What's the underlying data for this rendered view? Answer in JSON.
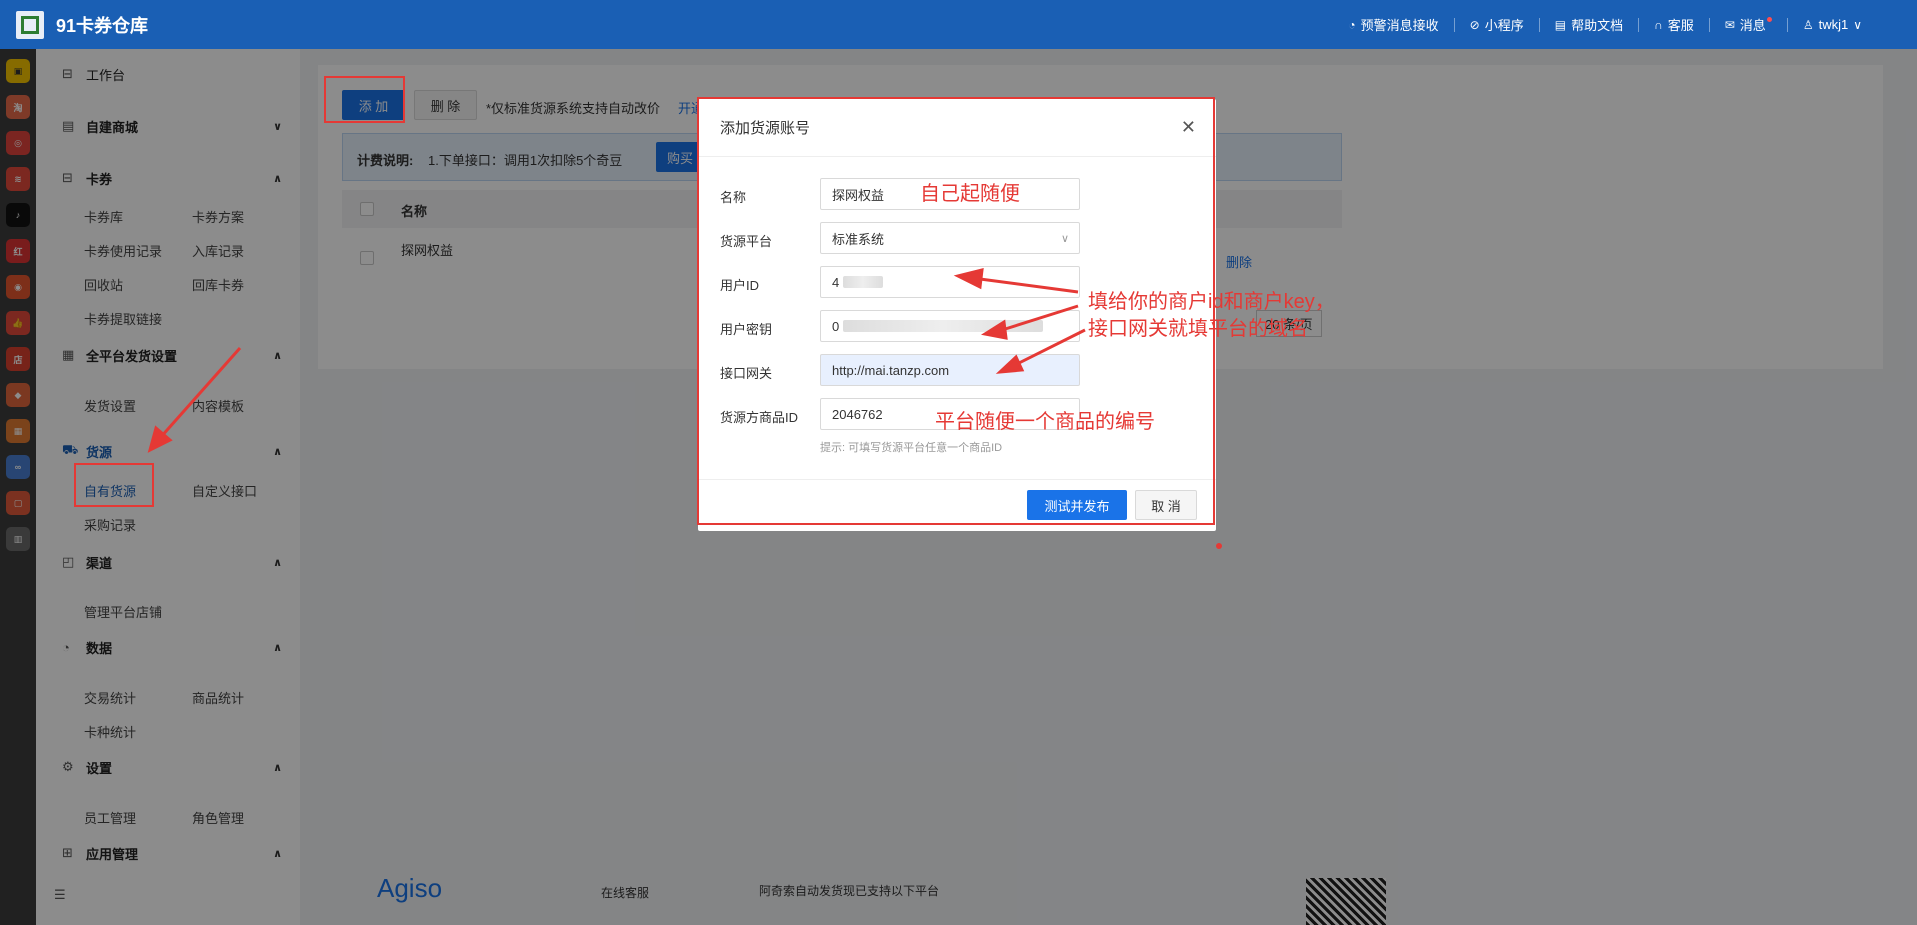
{
  "header": {
    "app_title": "91卡券仓库",
    "nav": [
      {
        "label": "预警消息接收",
        "icon": "alert-icon"
      },
      {
        "label": "小程序",
        "icon": "compass-icon"
      },
      {
        "label": "帮助文档",
        "icon": "document-icon"
      },
      {
        "label": "客服",
        "icon": "headset-icon"
      },
      {
        "label": "消息",
        "icon": "mail-icon"
      },
      {
        "label": "twkj1",
        "icon": "user-icon"
      }
    ]
  },
  "sidebar": {
    "workbench": "工作台",
    "groups": [
      {
        "label": "自建商城",
        "icon": "shop-icon",
        "expanded": false,
        "items": []
      },
      {
        "label": "卡券",
        "icon": "card-icon",
        "expanded": true,
        "items": [
          "卡券库",
          "卡券方案",
          "卡券使用记录",
          "入库记录",
          "回收站",
          "回库卡券",
          "卡券提取链接"
        ]
      },
      {
        "label": "全平台发货设置",
        "icon": "grid-icon",
        "expanded": true,
        "items": [
          "发货设置",
          "内容模板"
        ]
      },
      {
        "label": "货源",
        "icon": "cart-icon",
        "expanded": true,
        "items": [
          "自有货源",
          "自定义接口",
          "采购记录"
        ]
      },
      {
        "label": "渠道",
        "icon": "bag-icon",
        "expanded": true,
        "items": [
          "管理平台店铺"
        ]
      },
      {
        "label": "数据",
        "icon": "pie-icon",
        "expanded": true,
        "items": [
          "交易统计",
          "商品统计",
          "卡种统计"
        ]
      },
      {
        "label": "设置",
        "icon": "gear-icon",
        "expanded": true,
        "items": [
          "员工管理",
          "角色管理"
        ]
      },
      {
        "label": "应用管理",
        "icon": "apps-icon",
        "expanded": true,
        "items": []
      }
    ],
    "active_item": "自有货源"
  },
  "main": {
    "add_button": "添 加",
    "delete_button": "删 除",
    "tip": "*仅标准货源系统支持自动改价",
    "tip_link": "开通",
    "billing_label": "计费说明:",
    "billing_text": "1.下单接口：调用1次扣除5个奇豆",
    "buy_button": "购买",
    "table": {
      "col_name": "名称",
      "rows": [
        {
          "name": "探网权益",
          "action": "删除"
        }
      ]
    },
    "page_size": "20 条/页"
  },
  "footer": {
    "brand": "Agiso",
    "online_service": "在线客服",
    "platforms_text": "阿奇索自动发货现已支持以下平台"
  },
  "modal": {
    "title": "添加货源账号",
    "fields": [
      {
        "label": "名称",
        "value": "探网权益"
      },
      {
        "label": "货源平台",
        "value": "标准系统"
      },
      {
        "label": "用户ID",
        "value": "4"
      },
      {
        "label": "用户密钥",
        "value": "0"
      },
      {
        "label": "接口网关",
        "value": "http://mai.tanzp.com"
      },
      {
        "label": "货源方商品ID",
        "value": "2046762"
      }
    ],
    "hint": "提示: 可填写货源平台任意一个商品ID",
    "submit_button": "测试并发布",
    "cancel_button": "取 消"
  },
  "annotations": {
    "name_note": "自己起随便",
    "credentials_note_line1": "填给你的商户id和商户key，",
    "credentials_note_line2": "接口网关就填平台的域名",
    "product_note": "平台随便一个商品的编号"
  }
}
